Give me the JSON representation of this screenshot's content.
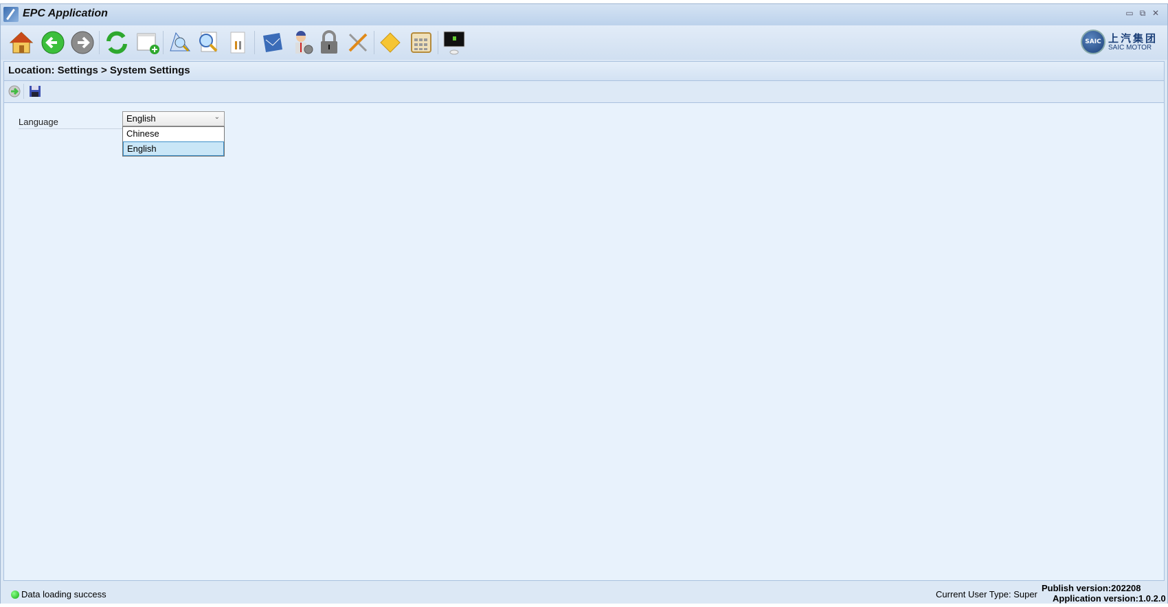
{
  "window": {
    "title": "EPC Application"
  },
  "toolbar": {
    "items": [
      "home",
      "back",
      "forward",
      "refresh",
      "new-window",
      "catalog-search",
      "part-search",
      "tools-doc",
      "map",
      "user-settings",
      "lock",
      "settings-tools",
      "note",
      "calculator",
      "monitor"
    ]
  },
  "logo": {
    "cn": "上汽集团",
    "en": "SAIC MOTOR",
    "badge": "SAIC"
  },
  "location": {
    "text": "Location:  Settings > System Settings"
  },
  "settings": {
    "language_label": "Language",
    "language_value": "English",
    "options": [
      "Chinese",
      "English"
    ]
  },
  "status": {
    "message": "Data loading success",
    "user_type": "Current User Type:  Super",
    "publish_version": "Publish version:202208",
    "application_version": "Application version:1.0.2.0"
  },
  "colors": {
    "accent": "#3d8fc8",
    "background": "#e8f2fc"
  }
}
